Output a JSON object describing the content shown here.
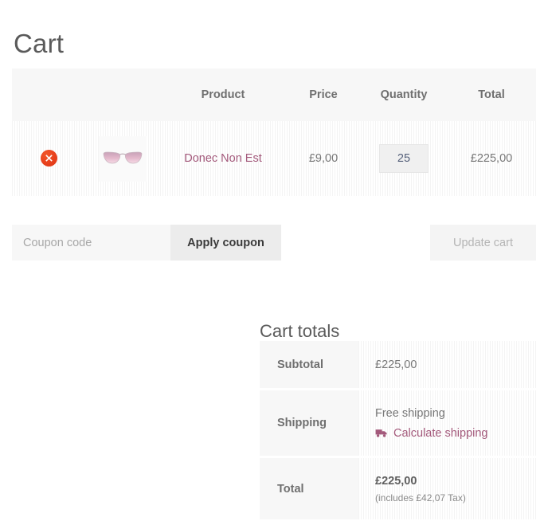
{
  "page": {
    "title": "Cart"
  },
  "cart_table": {
    "headers": {
      "remove": "",
      "thumbnail": "",
      "product": "Product",
      "price": "Price",
      "quantity": "Quantity",
      "total": "Total"
    },
    "rows": [
      {
        "remove_icon": "remove-circle-icon",
        "thumbnail_icon": "sunglasses-thumbnail",
        "product_name": "Donec Non Est",
        "price": "£9,00",
        "quantity": "25",
        "line_total": "£225,00"
      }
    ]
  },
  "actions": {
    "coupon_placeholder": "Coupon code",
    "coupon_value": "",
    "apply_coupon_label": "Apply coupon",
    "update_cart_label": "Update cart"
  },
  "cart_totals": {
    "title": "Cart totals",
    "rows": [
      {
        "label": "Subtotal",
        "value": "£225,00"
      },
      {
        "label": "Shipping",
        "value": "Free shipping",
        "link_label": "Calculate shipping",
        "link_icon": "delivery-truck-icon"
      },
      {
        "label": "Total",
        "value": "£225,00",
        "note": "(includes £42,07 Tax)"
      }
    ]
  },
  "colors": {
    "link": "#a3597b",
    "remove_button": "#e8401c",
    "panel_grey": "#f7f7f7",
    "text": "#6d6d6d"
  }
}
